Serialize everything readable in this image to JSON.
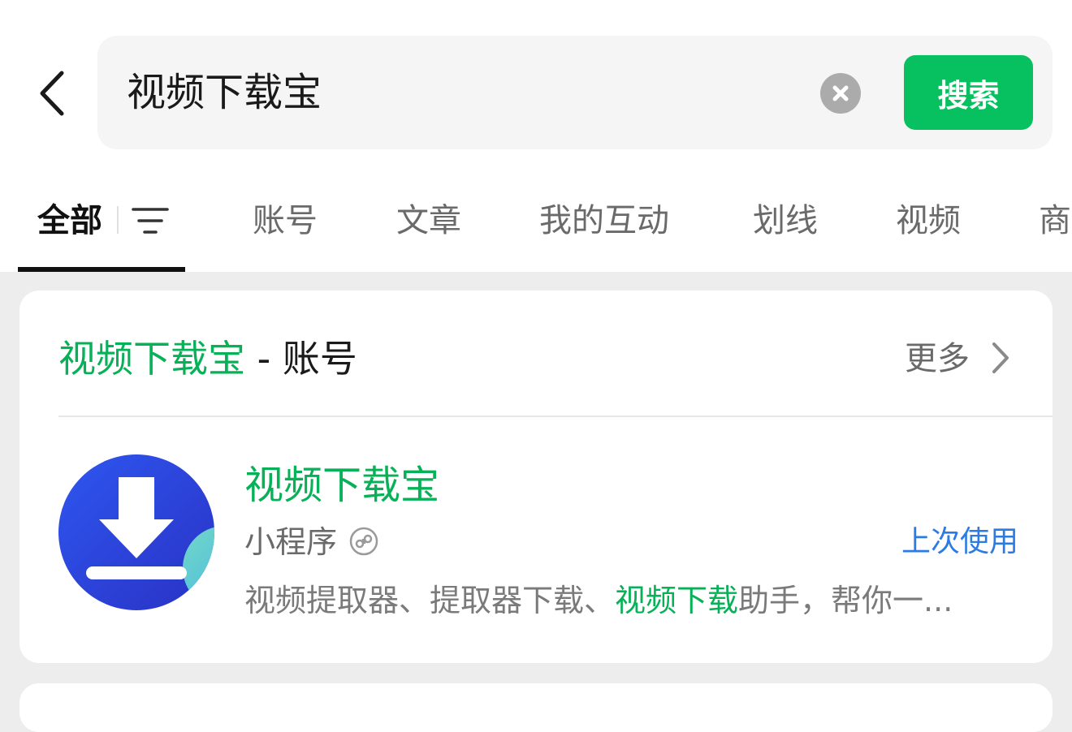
{
  "search": {
    "query": "视频下载宝",
    "button_label": "搜索"
  },
  "tabs": [
    {
      "label": "全部",
      "active": true
    },
    {
      "label": "账号"
    },
    {
      "label": "文章"
    },
    {
      "label": "我的互动"
    },
    {
      "label": "划线"
    },
    {
      "label": "视频"
    },
    {
      "label": "商"
    }
  ],
  "result_section": {
    "title_highlight": "视频下载宝",
    "title_suffix": " - 账号",
    "more_label": "更多",
    "item": {
      "name": "视频下载宝",
      "type": "小程序",
      "recent_label": "上次使用",
      "desc_part1": "视频提取器、提取器下载、",
      "desc_highlight": "视频下载",
      "desc_part2": "助手，帮你一..."
    }
  },
  "colors": {
    "accent_green": "#07c160",
    "link_blue": "#2c7be5",
    "icon_blue": "#2b3fd0"
  },
  "icons": [
    "back-chevron-icon",
    "clear-icon",
    "filter-icon",
    "chevron-right-icon",
    "download-app-icon",
    "mini-program-icon"
  ]
}
